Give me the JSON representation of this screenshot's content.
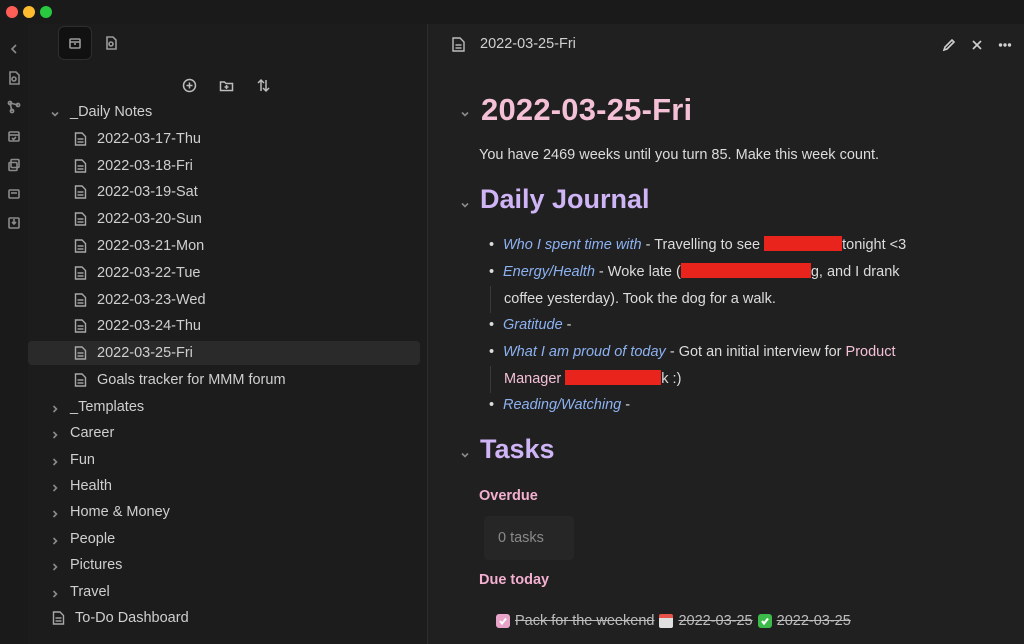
{
  "sidebar": {
    "tree": [
      {
        "label": "_Daily Notes",
        "kind": "folder-open"
      },
      {
        "label": "2022-03-17-Thu",
        "kind": "file"
      },
      {
        "label": "2022-03-18-Fri",
        "kind": "file"
      },
      {
        "label": "2022-03-19-Sat",
        "kind": "file"
      },
      {
        "label": "2022-03-20-Sun",
        "kind": "file"
      },
      {
        "label": "2022-03-21-Mon",
        "kind": "file"
      },
      {
        "label": "2022-03-22-Tue",
        "kind": "file"
      },
      {
        "label": "2022-03-23-Wed",
        "kind": "file"
      },
      {
        "label": "2022-03-24-Thu",
        "kind": "file"
      },
      {
        "label": "2022-03-25-Fri",
        "kind": "file",
        "selected": true
      },
      {
        "label": "Goals tracker for MMM forum",
        "kind": "file"
      },
      {
        "label": "_Templates",
        "kind": "folder"
      },
      {
        "label": "Career",
        "kind": "folder"
      },
      {
        "label": "Fun",
        "kind": "folder"
      },
      {
        "label": "Health",
        "kind": "folder"
      },
      {
        "label": "Home & Money",
        "kind": "folder"
      },
      {
        "label": "People",
        "kind": "folder"
      },
      {
        "label": "Pictures",
        "kind": "folder"
      },
      {
        "label": "Travel",
        "kind": "folder"
      },
      {
        "label": "To-Do Dashboard",
        "kind": "file"
      }
    ]
  },
  "editor": {
    "tab_title": "2022-03-25-Fri",
    "h1": "2022-03-25-Fri",
    "countdown": "You have 2469 weeks until you turn 85. Make this week count.",
    "journal_heading": "Daily Journal",
    "journal": {
      "who_field": "Who I spent time with",
      "who_text_a": " - Travelling to see ",
      "who_text_b": "tonight <3",
      "energy_field": "Energy/Health",
      "energy_text_a": " - Woke late (",
      "energy_text_b": "g, and I drank",
      "energy_cont": "coffee yesterday). Took the dog for a walk.",
      "gratitude_field": "Gratitude",
      "gratitude_text": " -",
      "proud_field": "What I am proud of today",
      "proud_text": " - Got an initial interview for ",
      "proud_pink": "Product",
      "proud_cont_pink": "Manager",
      "proud_cont_tail": "k :)",
      "reading_field": "Reading/Watching",
      "reading_text": " -"
    },
    "tasks_heading": "Tasks",
    "overdue_label": "Overdue",
    "overdue_count": "0 tasks",
    "due_today_label": "Due today",
    "task_text": "Pack for the weekend",
    "task_due_date": "2022-03-25",
    "task_done_date": "2022-03-25"
  },
  "colors": {
    "h1": "#f4c0d6",
    "h2": "#cfb4f6",
    "field": "#8db2f2",
    "redaction": "#e8241c"
  }
}
